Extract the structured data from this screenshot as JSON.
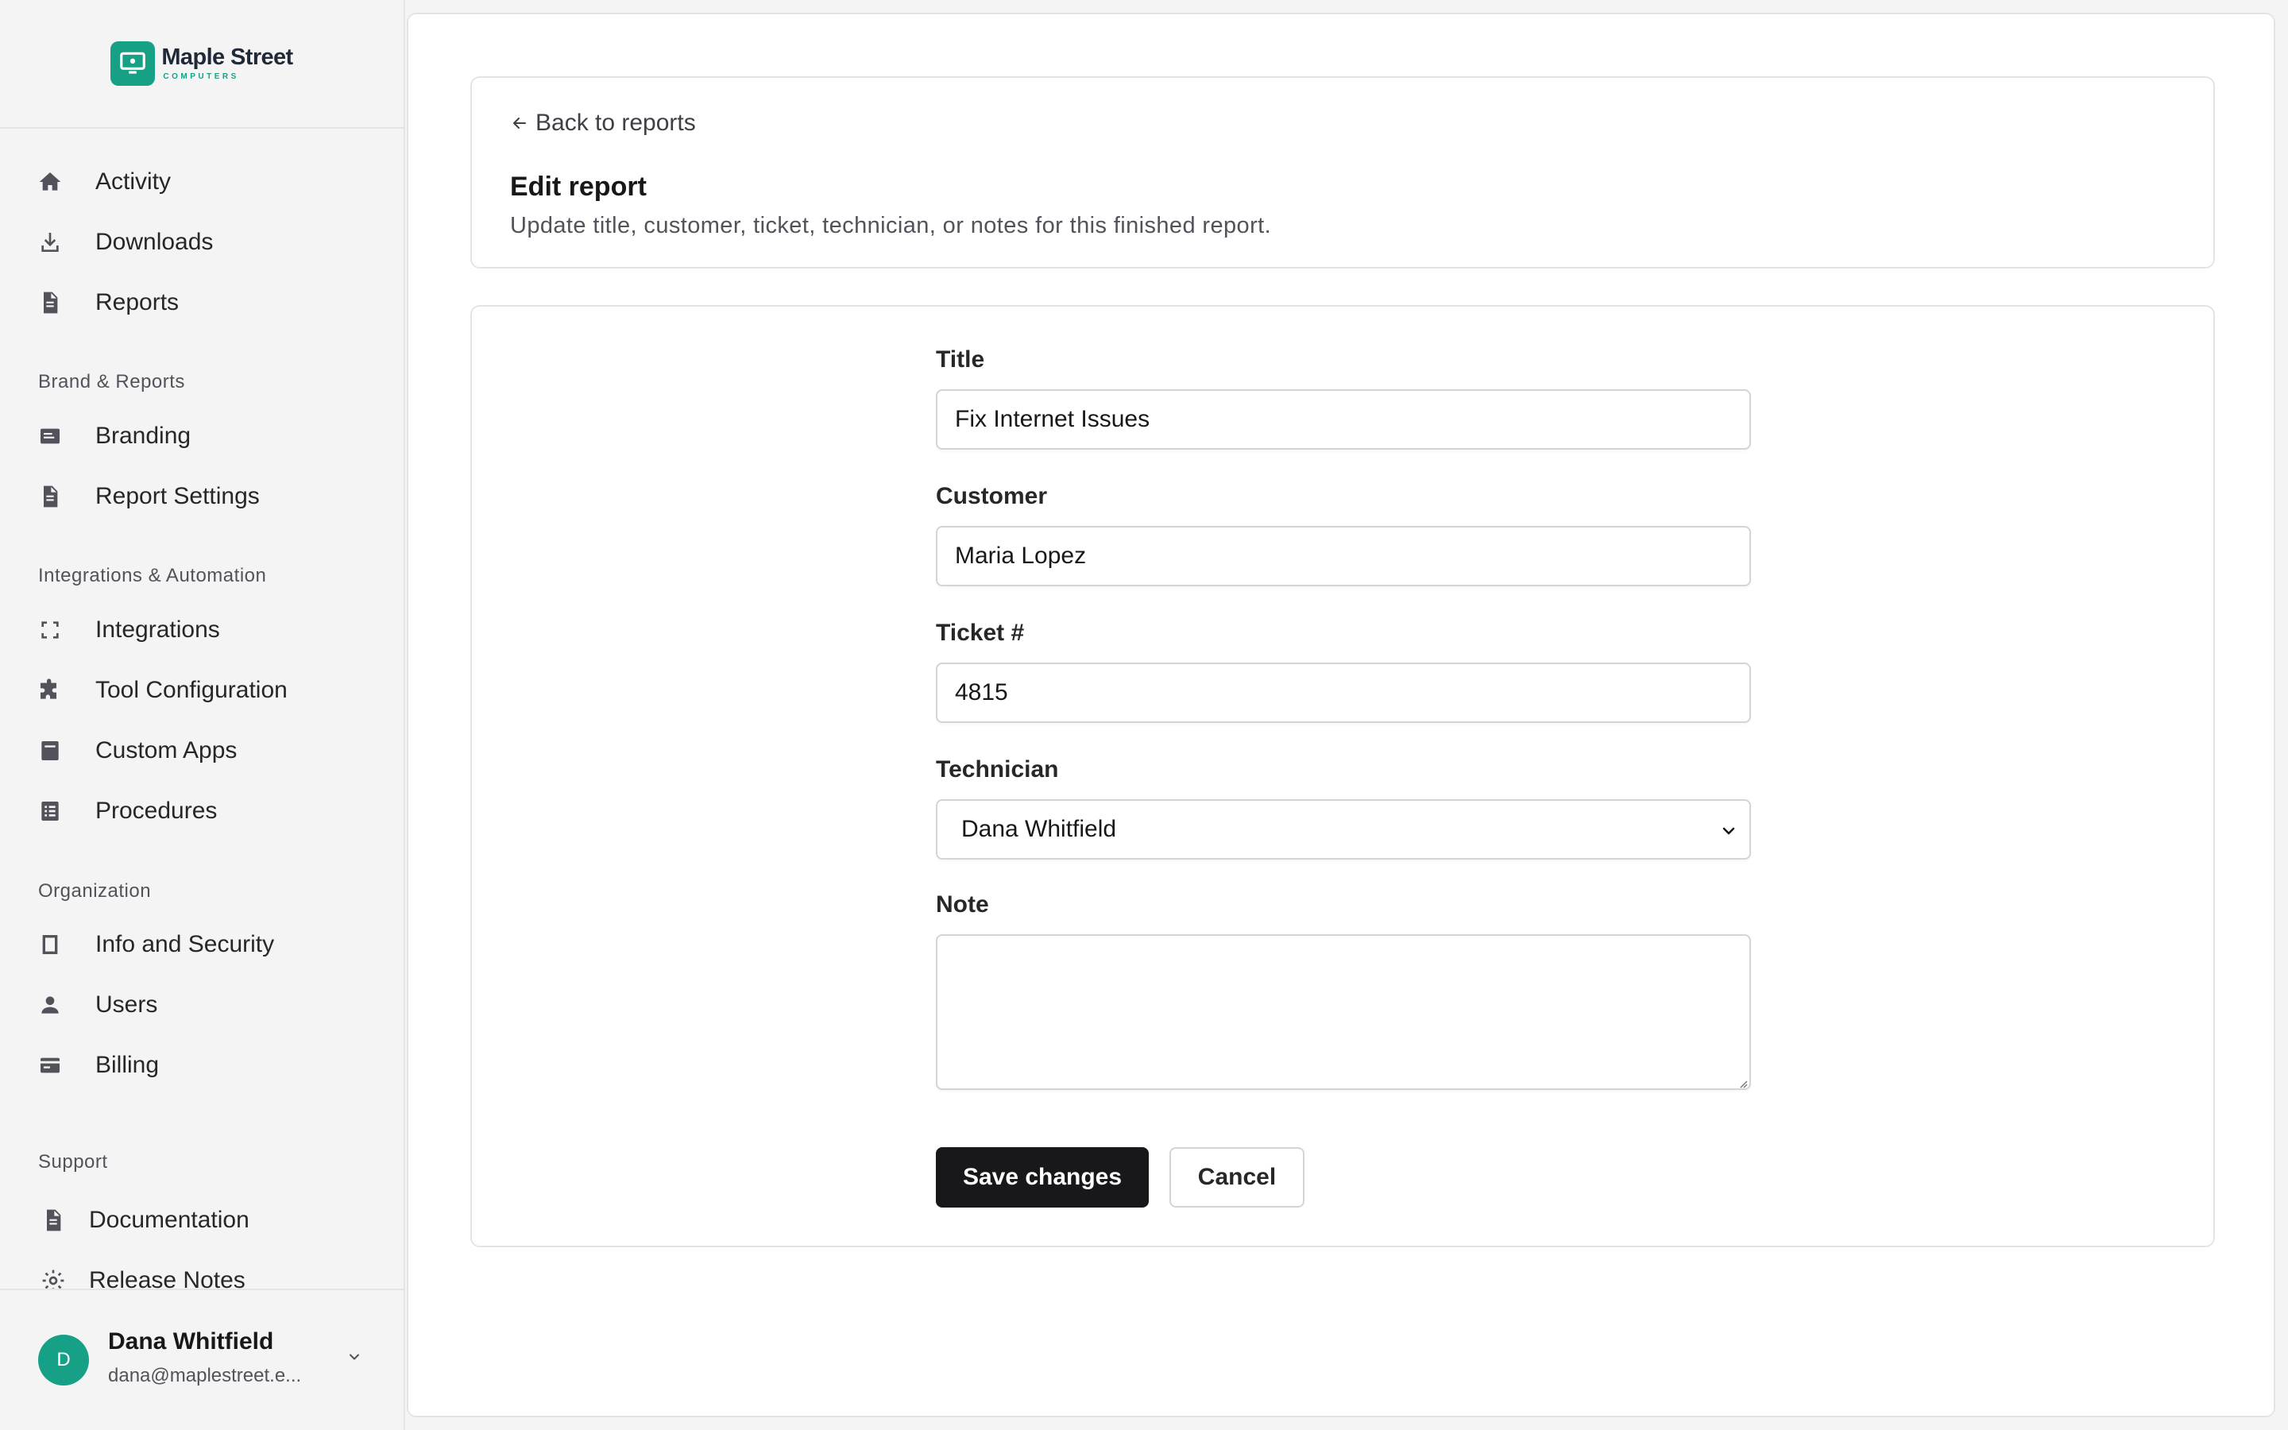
{
  "brand": {
    "name": "Maple Street",
    "tagline": "COMPUTERS",
    "accent_color": "#16a085"
  },
  "sidebar": {
    "items": [
      {
        "label": "Activity",
        "icon": "home-icon"
      },
      {
        "label": "Downloads",
        "icon": "download-icon"
      },
      {
        "label": "Reports",
        "icon": "document-icon"
      },
      {
        "label": "Branding",
        "icon": "card-icon"
      },
      {
        "label": "Report Settings",
        "icon": "document-icon"
      },
      {
        "label": "Integrations",
        "icon": "dashed-square-icon"
      },
      {
        "label": "Tool Configuration",
        "icon": "puzzle-icon"
      },
      {
        "label": "Custom Apps",
        "icon": "app-icon"
      },
      {
        "label": "Procedures",
        "icon": "list-icon"
      },
      {
        "label": "Info and Security",
        "icon": "square-icon"
      },
      {
        "label": "Users",
        "icon": "user-icon"
      },
      {
        "label": "Billing",
        "icon": "credit-card-icon"
      },
      {
        "label": "Documentation",
        "icon": "document-icon"
      },
      {
        "label": "Release Notes",
        "icon": "gear-icon"
      }
    ],
    "sections": {
      "brand_reports": "Brand & Reports",
      "integrations": "Integrations & Automation",
      "organization": "Organization",
      "support": "Support"
    }
  },
  "user": {
    "initial": "D",
    "name": "Dana Whitfield",
    "email": "dana@maplestreet.e..."
  },
  "header": {
    "back_label": "Back to reports",
    "title": "Edit report",
    "subtitle": "Update title, customer, ticket, technician, or notes for this finished report."
  },
  "form": {
    "title_label": "Title",
    "title_value": "Fix Internet Issues",
    "customer_label": "Customer",
    "customer_value": "Maria Lopez",
    "ticket_label": "Ticket #",
    "ticket_value": "4815",
    "technician_label": "Technician",
    "technician_value": "Dana Whitfield",
    "note_label": "Note",
    "note_value": "",
    "save_label": "Save changes",
    "cancel_label": "Cancel"
  }
}
